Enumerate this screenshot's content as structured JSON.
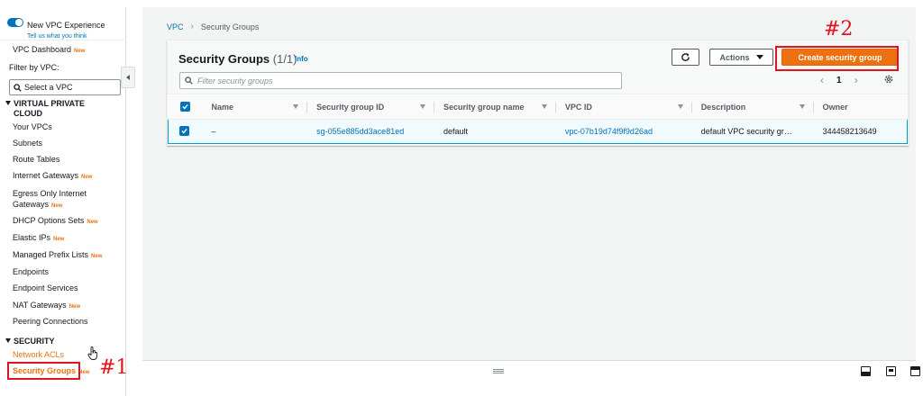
{
  "sidebar": {
    "new_experience_title": "New VPC Experience",
    "new_experience_link": "Tell us what you think",
    "vpc_dashboard": "VPC Dashboard",
    "new_badge": "New",
    "filter_label": "Filter by VPC:",
    "select_vpc_placeholder": "Select a VPC",
    "section_vpc_line1": "VIRTUAL PRIVATE",
    "section_vpc_line2": "CLOUD",
    "items": [
      {
        "label": "Your VPCs"
      },
      {
        "label": "Subnets"
      },
      {
        "label": "Route Tables"
      },
      {
        "label": "Internet Gateways",
        "badge": "New"
      },
      {
        "label_line1": "Egress Only Internet",
        "label_line2": "Gateways",
        "badge": "New"
      },
      {
        "label": "DHCP Options Sets",
        "badge": "New"
      },
      {
        "label": "Elastic IPs",
        "badge": "New"
      },
      {
        "label": "Managed Prefix Lists",
        "badge": "New"
      },
      {
        "label": "Endpoints"
      },
      {
        "label": "Endpoint Services"
      },
      {
        "label": "NAT Gateways",
        "badge": "New"
      },
      {
        "label": "Peering Connections"
      }
    ],
    "section_security": "SECURITY",
    "network_acls": "Network ACLs",
    "security_groups": "Security Groups",
    "security_groups_badge": "New"
  },
  "breadcrumb": {
    "root": "VPC",
    "current": "Security Groups"
  },
  "panel": {
    "title": "Security Groups",
    "count": "(1/1)",
    "info": "Info",
    "actions_label": "Actions",
    "create_label": "Create security group",
    "search_placeholder": "Filter security groups",
    "page_number": "1"
  },
  "table": {
    "columns": [
      "Name",
      "Security group ID",
      "Security group name",
      "VPC ID",
      "Description",
      "Owner"
    ],
    "rows": [
      {
        "name": "–",
        "security_group_id": "sg-055e885dd3ace81ed",
        "security_group_name": "default",
        "vpc_id": "vpc-07b19d74f9f9d26ad",
        "description": "default VPC security gr…",
        "owner": "344458213649"
      }
    ]
  },
  "annotations": {
    "label_1": "#1",
    "label_2": "#2"
  },
  "colors": {
    "accent_orange": "#ec7211",
    "link_blue": "#0073bb",
    "annotation_red": "#e0141e"
  },
  "icons": [
    "toggle-switch-icon",
    "search-icon",
    "collapse-arrow-icon",
    "refresh-icon",
    "caret-down-icon",
    "settings-gear-icon",
    "checkbox-checked-icon",
    "chevron-left-icon",
    "chevron-right-icon",
    "cursor-hand-icon"
  ]
}
